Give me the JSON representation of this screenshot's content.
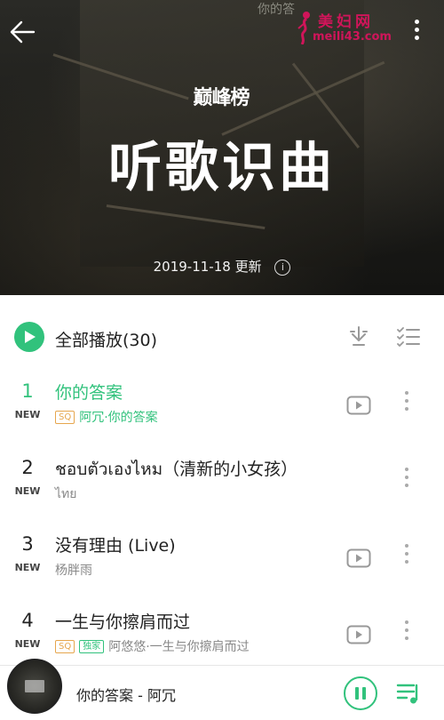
{
  "header": {
    "cover_text_top": "你的答",
    "hot_logo": "巅峰榜",
    "title": "听歌识曲",
    "update_date": "2019-11-18",
    "update_label": "更新",
    "info_icon_glyph": "i"
  },
  "watermark": {
    "title": "美妇网",
    "url": "meili43.com",
    "color": "#d0155a"
  },
  "play_all": {
    "label": "全部播放",
    "count": "(30)"
  },
  "songs": [
    {
      "rank": "1",
      "new_tag": "NEW",
      "title": "你的答案",
      "badges": [
        "SQ"
      ],
      "subtitle": "阿冗·你的答案",
      "has_mv": true,
      "active": true
    },
    {
      "rank": "2",
      "new_tag": "NEW",
      "title": "ชอบตัวเองไหม（清新的小女孩）",
      "badges": [],
      "subtitle": "ไทย",
      "has_mv": false,
      "active": false
    },
    {
      "rank": "3",
      "new_tag": "NEW",
      "title": "没有理由 (Live)",
      "badges": [],
      "subtitle": "杨胖雨",
      "has_mv": true,
      "active": false
    },
    {
      "rank": "4",
      "new_tag": "NEW",
      "title": "一生与你擦肩而过",
      "badges": [
        "SQ",
        "独家"
      ],
      "subtitle": "阿悠悠·一生与你擦肩而过",
      "has_mv": true,
      "active": false
    }
  ],
  "player": {
    "now_playing": "你的答案 - 阿冗",
    "state": "playing"
  },
  "colors": {
    "accent": "#31c27c",
    "sq_badge": "#e6a64d",
    "text": "#222222",
    "subtext": "#888888"
  },
  "icons": {
    "back": "arrow-left-icon",
    "more": "vertical-dots-icon",
    "play_all": "play-icon",
    "download": "download-icon",
    "multi_select": "checklist-icon",
    "mv": "video-play-icon",
    "pause": "pause-icon",
    "playlist": "playlist-icon"
  }
}
